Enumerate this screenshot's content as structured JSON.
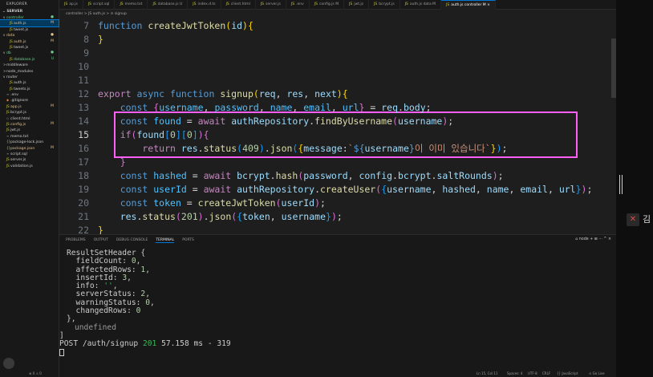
{
  "explorer": {
    "title": "EXPLORER",
    "folder": "SERVER",
    "items": [
      {
        "chev": "v",
        "icon": "",
        "label": "controller",
        "badge": "●",
        "badge_class": "mod-g",
        "depth": 1
      },
      {
        "chev": "",
        "icon": "JS",
        "label": "auth.js",
        "badge": "M",
        "badge_class": "mod-y",
        "depth": 2,
        "active": true
      },
      {
        "chev": "",
        "icon": "JS",
        "label": "tweet.js",
        "badge": "",
        "badge_class": "",
        "depth": 2
      },
      {
        "chev": "v",
        "icon": "",
        "label": "data",
        "badge": "●",
        "badge_class": "mod-y",
        "depth": 1
      },
      {
        "chev": "",
        "icon": "JS",
        "label": "auth.js",
        "badge": "M",
        "badge_class": "mod-y",
        "depth": 2
      },
      {
        "chev": "",
        "icon": "JS",
        "label": "tweet.js",
        "badge": "",
        "badge_class": "",
        "depth": 2
      },
      {
        "chev": "v",
        "icon": "",
        "label": "db",
        "badge": "●",
        "badge_class": "mod-g",
        "depth": 1
      },
      {
        "chev": "",
        "icon": "JS",
        "label": "database.js",
        "badge": "U",
        "badge_class": "mod-g",
        "depth": 2
      },
      {
        "chev": ">",
        "icon": "",
        "label": "middleware",
        "badge": "",
        "badge_class": "",
        "depth": 1
      },
      {
        "chev": ">",
        "icon": "",
        "label": "node_modules",
        "badge": "",
        "badge_class": "",
        "depth": 1
      },
      {
        "chev": "v",
        "icon": "",
        "label": "router",
        "badge": "",
        "badge_class": "",
        "depth": 1
      },
      {
        "chev": "",
        "icon": "JS",
        "label": "auth.js",
        "badge": "",
        "badge_class": "",
        "depth": 2
      },
      {
        "chev": "",
        "icon": "JS",
        "label": "tweets.js",
        "badge": "",
        "badge_class": "",
        "depth": 2
      },
      {
        "chev": "",
        "icon": "≡",
        "label": ".env",
        "badge": "",
        "badge_class": "",
        "depth": 1
      },
      {
        "chev": "",
        "icon": "◆",
        "label": ".gitignore",
        "badge": "",
        "badge_class": "",
        "depth": 1
      },
      {
        "chev": "",
        "icon": "JS",
        "label": "app.js",
        "badge": "M",
        "badge_class": "mod-y",
        "depth": 1
      },
      {
        "chev": "",
        "icon": "JS",
        "label": "bcrypt.js",
        "badge": "",
        "badge_class": "",
        "depth": 1
      },
      {
        "chev": "",
        "icon": "◇",
        "label": "client.html",
        "badge": "",
        "badge_class": "",
        "depth": 1
      },
      {
        "chev": "",
        "icon": "JS",
        "label": "config.js",
        "badge": "M",
        "badge_class": "mod-y",
        "depth": 1
      },
      {
        "chev": "",
        "icon": "JS",
        "label": "jwt.js",
        "badge": "",
        "badge_class": "",
        "depth": 1
      },
      {
        "chev": "",
        "icon": "≡",
        "label": "memo.txt",
        "badge": "",
        "badge_class": "",
        "depth": 1
      },
      {
        "chev": "",
        "icon": "{}",
        "label": "package-lock.json",
        "badge": "",
        "badge_class": "",
        "depth": 1
      },
      {
        "chev": "",
        "icon": "{}",
        "label": "package.json",
        "badge": "M",
        "badge_class": "mod-y",
        "depth": 1
      },
      {
        "chev": "",
        "icon": "≡",
        "label": "script.sql",
        "badge": "",
        "badge_class": "",
        "depth": 1
      },
      {
        "chev": "",
        "icon": "JS",
        "label": "server.js",
        "badge": "",
        "badge_class": "",
        "depth": 1
      },
      {
        "chev": "",
        "icon": "JS",
        "label": "validation.js",
        "badge": "",
        "badge_class": "",
        "depth": 1
      }
    ],
    "footer": "⊗ 0 ⚠ 0"
  },
  "tabs": [
    {
      "label": "ap.js",
      "active": false
    },
    {
      "label": "script.sql",
      "active": false
    },
    {
      "label": "memo.txt",
      "active": false
    },
    {
      "label": "database.js U",
      "active": false
    },
    {
      "label": "index.d.ts",
      "active": false
    },
    {
      "label": "client.html",
      "active": false
    },
    {
      "label": "server.js",
      "active": false
    },
    {
      "label": ".env",
      "active": false
    },
    {
      "label": "config.js M",
      "active": false
    },
    {
      "label": "jwt.js",
      "active": false
    },
    {
      "label": "bcrypt.js",
      "active": false
    },
    {
      "label": "auth.js data M",
      "active": false
    },
    {
      "label": "auth.js controller M ×",
      "active": true
    }
  ],
  "breadcrumb": "controller > JS auth.js > ⊙ signup",
  "editor": {
    "lines": [
      {
        "n": "7",
        "tokens": [
          [
            "kw",
            "function "
          ],
          [
            "fn",
            "createJwtToken"
          ],
          [
            "b1",
            "("
          ],
          [
            "vr",
            "id"
          ],
          [
            "b1",
            ")"
          ],
          [
            "b1",
            "{"
          ]
        ]
      },
      {
        "n": "8",
        "tokens": [
          [
            "b1",
            "}"
          ]
        ]
      },
      {
        "n": "9",
        "tokens": []
      },
      {
        "n": "10",
        "tokens": []
      },
      {
        "n": "11",
        "tokens": []
      },
      {
        "n": "12",
        "tokens": [
          [
            "kw2",
            "export "
          ],
          [
            "kw",
            "async "
          ],
          [
            "kw",
            "function "
          ],
          [
            "fn",
            "signup"
          ],
          [
            "b1",
            "("
          ],
          [
            "vr",
            "req"
          ],
          [
            "pu",
            ", "
          ],
          [
            "vr",
            "res"
          ],
          [
            "pu",
            ", "
          ],
          [
            "vr",
            "next"
          ],
          [
            "b1",
            ")"
          ],
          [
            "b1",
            "{"
          ]
        ]
      },
      {
        "n": "13",
        "tokens": [
          [
            "kw",
            "    const "
          ],
          [
            "b2",
            "{"
          ],
          [
            "cn",
            "username"
          ],
          [
            "pu",
            ", "
          ],
          [
            "cn",
            "password"
          ],
          [
            "pu",
            ", "
          ],
          [
            "cn",
            "name"
          ],
          [
            "pu",
            ", "
          ],
          [
            "cn",
            "email"
          ],
          [
            "pu",
            ", "
          ],
          [
            "cn",
            "url"
          ],
          [
            "b2",
            "}"
          ],
          [
            "pu",
            " = "
          ],
          [
            "vr",
            "req"
          ],
          [
            "pu",
            "."
          ],
          [
            "vr",
            "body"
          ],
          [
            "pu",
            ";"
          ]
        ]
      },
      {
        "n": "14",
        "tokens": [
          [
            "kw",
            "    const "
          ],
          [
            "cn",
            "found"
          ],
          [
            "pu",
            " = "
          ],
          [
            "kw2",
            "await "
          ],
          [
            "vr",
            "authRepository"
          ],
          [
            "pu",
            "."
          ],
          [
            "fn",
            "findByUsername"
          ],
          [
            "b2",
            "("
          ],
          [
            "vr",
            "username"
          ],
          [
            "b2",
            ")"
          ],
          [
            "pu",
            ";"
          ]
        ]
      },
      {
        "n": "15",
        "cur": true,
        "tokens": [
          [
            "kw2",
            "    if"
          ],
          [
            "b2",
            "("
          ],
          [
            "vr",
            "found"
          ],
          [
            "b3",
            "["
          ],
          [
            "nm",
            "0"
          ],
          [
            "b3",
            "]"
          ],
          [
            "b3",
            "["
          ],
          [
            "nm",
            "0"
          ],
          [
            "b3",
            "]"
          ],
          [
            "b2",
            ")"
          ],
          [
            "b2",
            "{"
          ]
        ]
      },
      {
        "n": "16",
        "tokens": [
          [
            "kw2",
            "        return "
          ],
          [
            "vr",
            "res"
          ],
          [
            "pu",
            "."
          ],
          [
            "fn",
            "status"
          ],
          [
            "b3",
            "("
          ],
          [
            "nm",
            "409"
          ],
          [
            "b3",
            ")"
          ],
          [
            "pu",
            "."
          ],
          [
            "fn",
            "json"
          ],
          [
            "b3",
            "("
          ],
          [
            "b1",
            "{"
          ],
          [
            "vr",
            "message"
          ],
          [
            "pu",
            ":"
          ],
          [
            "st",
            "`"
          ],
          [
            "kw",
            "${"
          ],
          [
            "vr",
            "username"
          ],
          [
            "kw",
            "}"
          ],
          [
            "st",
            "이 이미 있습니다`"
          ],
          [
            "b1",
            "}"
          ],
          [
            "b3",
            ")"
          ],
          [
            "pu",
            ";"
          ]
        ]
      },
      {
        "n": "17",
        "tokens": [
          [
            "b2",
            "    }"
          ]
        ]
      },
      {
        "n": "18",
        "tokens": [
          [
            "kw",
            "    const "
          ],
          [
            "cn",
            "hashed"
          ],
          [
            "pu",
            " = "
          ],
          [
            "kw2",
            "await "
          ],
          [
            "vr",
            "bcrypt"
          ],
          [
            "pu",
            "."
          ],
          [
            "fn",
            "hash"
          ],
          [
            "b2",
            "("
          ],
          [
            "vr",
            "password"
          ],
          [
            "pu",
            ", "
          ],
          [
            "vr",
            "config"
          ],
          [
            "pu",
            "."
          ],
          [
            "vr",
            "bcrypt"
          ],
          [
            "pu",
            "."
          ],
          [
            "vr",
            "saltRounds"
          ],
          [
            "b2",
            ")"
          ],
          [
            "pu",
            ";"
          ]
        ]
      },
      {
        "n": "19",
        "tokens": [
          [
            "kw",
            "    const "
          ],
          [
            "cn",
            "userId"
          ],
          [
            "pu",
            " = "
          ],
          [
            "kw2",
            "await "
          ],
          [
            "vr",
            "authRepository"
          ],
          [
            "pu",
            "."
          ],
          [
            "fn",
            "createUser"
          ],
          [
            "b2",
            "("
          ],
          [
            "b3",
            "{"
          ],
          [
            "vr",
            "username"
          ],
          [
            "pu",
            ", "
          ],
          [
            "vr",
            "hashed"
          ],
          [
            "pu",
            ", "
          ],
          [
            "vr",
            "name"
          ],
          [
            "pu",
            ", "
          ],
          [
            "vr",
            "email"
          ],
          [
            "pu",
            ", "
          ],
          [
            "vr",
            "url"
          ],
          [
            "b3",
            "}"
          ],
          [
            "b2",
            ")"
          ],
          [
            "pu",
            ";"
          ]
        ]
      },
      {
        "n": "20",
        "tokens": [
          [
            "kw",
            "    const "
          ],
          [
            "cn",
            "token"
          ],
          [
            "pu",
            " = "
          ],
          [
            "fn",
            "createJwtToken"
          ],
          [
            "b2",
            "("
          ],
          [
            "vr",
            "userId"
          ],
          [
            "b2",
            ")"
          ],
          [
            "pu",
            ";"
          ]
        ]
      },
      {
        "n": "21",
        "tokens": [
          [
            "vr",
            "    res"
          ],
          [
            "pu",
            "."
          ],
          [
            "fn",
            "status"
          ],
          [
            "b2",
            "("
          ],
          [
            "nm",
            "201"
          ],
          [
            "b2",
            ")"
          ],
          [
            "pu",
            "."
          ],
          [
            "fn",
            "json"
          ],
          [
            "b2",
            "("
          ],
          [
            "b3",
            "{"
          ],
          [
            "vr",
            "token"
          ],
          [
            "pu",
            ", "
          ],
          [
            "vr",
            "username"
          ],
          [
            "b3",
            "}"
          ],
          [
            "b2",
            ")"
          ],
          [
            "pu",
            ";"
          ]
        ]
      },
      {
        "n": "22",
        "tokens": [
          [
            "b1",
            "}"
          ]
        ]
      },
      {
        "n": "23",
        "tokens": []
      }
    ]
  },
  "panel": {
    "tabs": [
      "PROBLEMS",
      "OUTPUT",
      "DEBUG CONSOLE",
      "TERMINAL",
      "PORTS"
    ],
    "active_tab": "TERMINAL",
    "tools": "⌂ node + ⊞ ··· ^ ×"
  },
  "terminal": {
    "lines": [
      {
        "text": "ResultSetHeader {",
        "cls": ""
      },
      {
        "text": "  fieldCount: ",
        "value": "0",
        "vcls": "num",
        "tail": ","
      },
      {
        "text": "  affectedRows: ",
        "value": "1",
        "vcls": "num",
        "tail": ","
      },
      {
        "text": "  insertId: ",
        "value": "3",
        "vcls": "num",
        "tail": ","
      },
      {
        "text": "  info: ",
        "value": "''",
        "vcls": "str",
        "tail": ","
      },
      {
        "text": "  serverStatus: ",
        "value": "2",
        "vcls": "num",
        "tail": ","
      },
      {
        "text": "  warningStatus: ",
        "value": "0",
        "vcls": "num",
        "tail": ","
      },
      {
        "text": "  changedRows: ",
        "value": "0",
        "vcls": "num",
        "tail": ""
      },
      {
        "text": "},",
        "cls": ""
      },
      {
        "text": "undefined",
        "cls": "dim"
      },
      {
        "text": "]",
        "cls": ""
      },
      {
        "text": "POST /auth/signup ",
        "value": "201",
        "vcls": "ok",
        "tail": " 57.158 ms - 319"
      }
    ]
  },
  "statusbar": {
    "position": "Ln 15, Col 11",
    "spaces": "Spaces: 4",
    "encoding": "UTF-8",
    "eol": "CRLF",
    "language": "{} JavaScript",
    "golive": "⊙ Go Live"
  },
  "overlay": {
    "user_label": "김"
  }
}
